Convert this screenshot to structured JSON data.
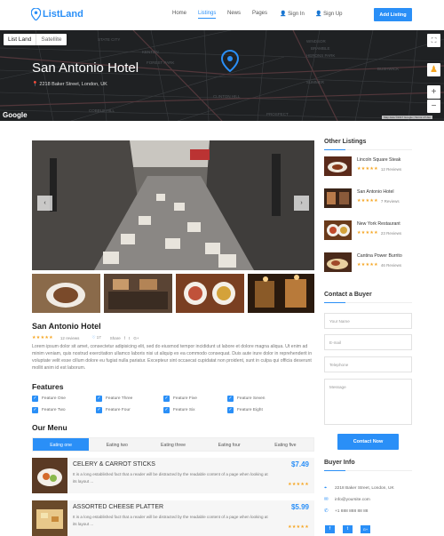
{
  "header": {
    "logo": "ListLand",
    "nav": [
      "Home",
      "Listings",
      "News",
      "Pages",
      "Sign In",
      "Sign Up"
    ],
    "add_button": "Add Listing"
  },
  "map": {
    "tab_map": "List Land",
    "tab_satellite": "Satellite",
    "title": "San Antonio Hotel",
    "address": "2218 Baker Street, London, UK",
    "zoom_in": "+",
    "zoom_out": "−",
    "brand": "Google",
    "map_data": "Map data ©2017 Google | Terms of Use",
    "street_labels": [
      "STATE CITY",
      "KENTON",
      "FOREST PARK",
      "WINDSOR",
      "BRAMBLE",
      "HERONS PARK",
      "SUMMER",
      "BUSHWICK",
      "CLINTON HILL",
      "COBBLE HILL",
      "PROSPECT"
    ]
  },
  "listing": {
    "title": "San Antonio Hotel",
    "reviews": "12 reviews",
    "likes": "17",
    "share": "Share",
    "social": [
      "f",
      "t",
      "G+"
    ],
    "description": "Lorem ipsum dolor sit amet, consectetur adipisicing elit, sed do eiusmod tempor incididunt ut labore et dolore magna aliqua. Ut enim ad minim veniam, quis nostrud exercitation ullamco laboris nisi ut aliquip ex ea commodo consequat. Duis aute irure dolor in reprehenderit in voluptate velit esse cillum dolore eu fugiat nulla pariatur. Excepteur sint occaecat cupidatat non proident, sunt in culpa qui officia deserunt mollit anim id est laborum."
  },
  "features": {
    "heading": "Features",
    "items": [
      "Feature One",
      "Feature Two",
      "Feature Three",
      "Feature Four",
      "Feature Five",
      "Feature Six",
      "Feature Seven",
      "Feature Eight"
    ]
  },
  "menu": {
    "heading": "Our Menu",
    "tabs": [
      "Eating one",
      "Eating two",
      "Eating three",
      "Eating four",
      "Eating five"
    ],
    "items": [
      {
        "title": "CELERY & CARROT STICKS",
        "desc": "It is a long established fact that a reader will be distracted by the readable content of a page when looking at its layout ...",
        "price": "$7.49"
      },
      {
        "title": "ASSORTED CHEESE PLATTER",
        "desc": "It is a long established fact that a reader will be distracted by the readable content of a page when looking at its layout ...",
        "price": "$5.99"
      }
    ]
  },
  "sidebar": {
    "other_heading": "Other Listings",
    "others": [
      {
        "name": "Lincoln Square Steak",
        "reviews": "12 Reviews"
      },
      {
        "name": "San Antonio Hotel",
        "reviews": "7 Reviews"
      },
      {
        "name": "New York Restaurant",
        "reviews": "23 Reviews"
      },
      {
        "name": "Cantina Power Burrito",
        "reviews": "46 Reviews"
      }
    ],
    "contact_heading": "Contact a Buyer",
    "fields": {
      "name": "Your Name",
      "email": "E-mail",
      "phone": "Telephone",
      "message": "Message"
    },
    "contact_button": "Contact Now",
    "info_heading": "Buyer Info",
    "info": {
      "address": "2218 Baker Street, London, UK",
      "email": "info@yoursite.com",
      "phone": "+1 888 888 88 88"
    }
  },
  "colors": {
    "accent": "#2a8ff7",
    "star": "#f6a623",
    "map_bg": "#1f2123"
  }
}
